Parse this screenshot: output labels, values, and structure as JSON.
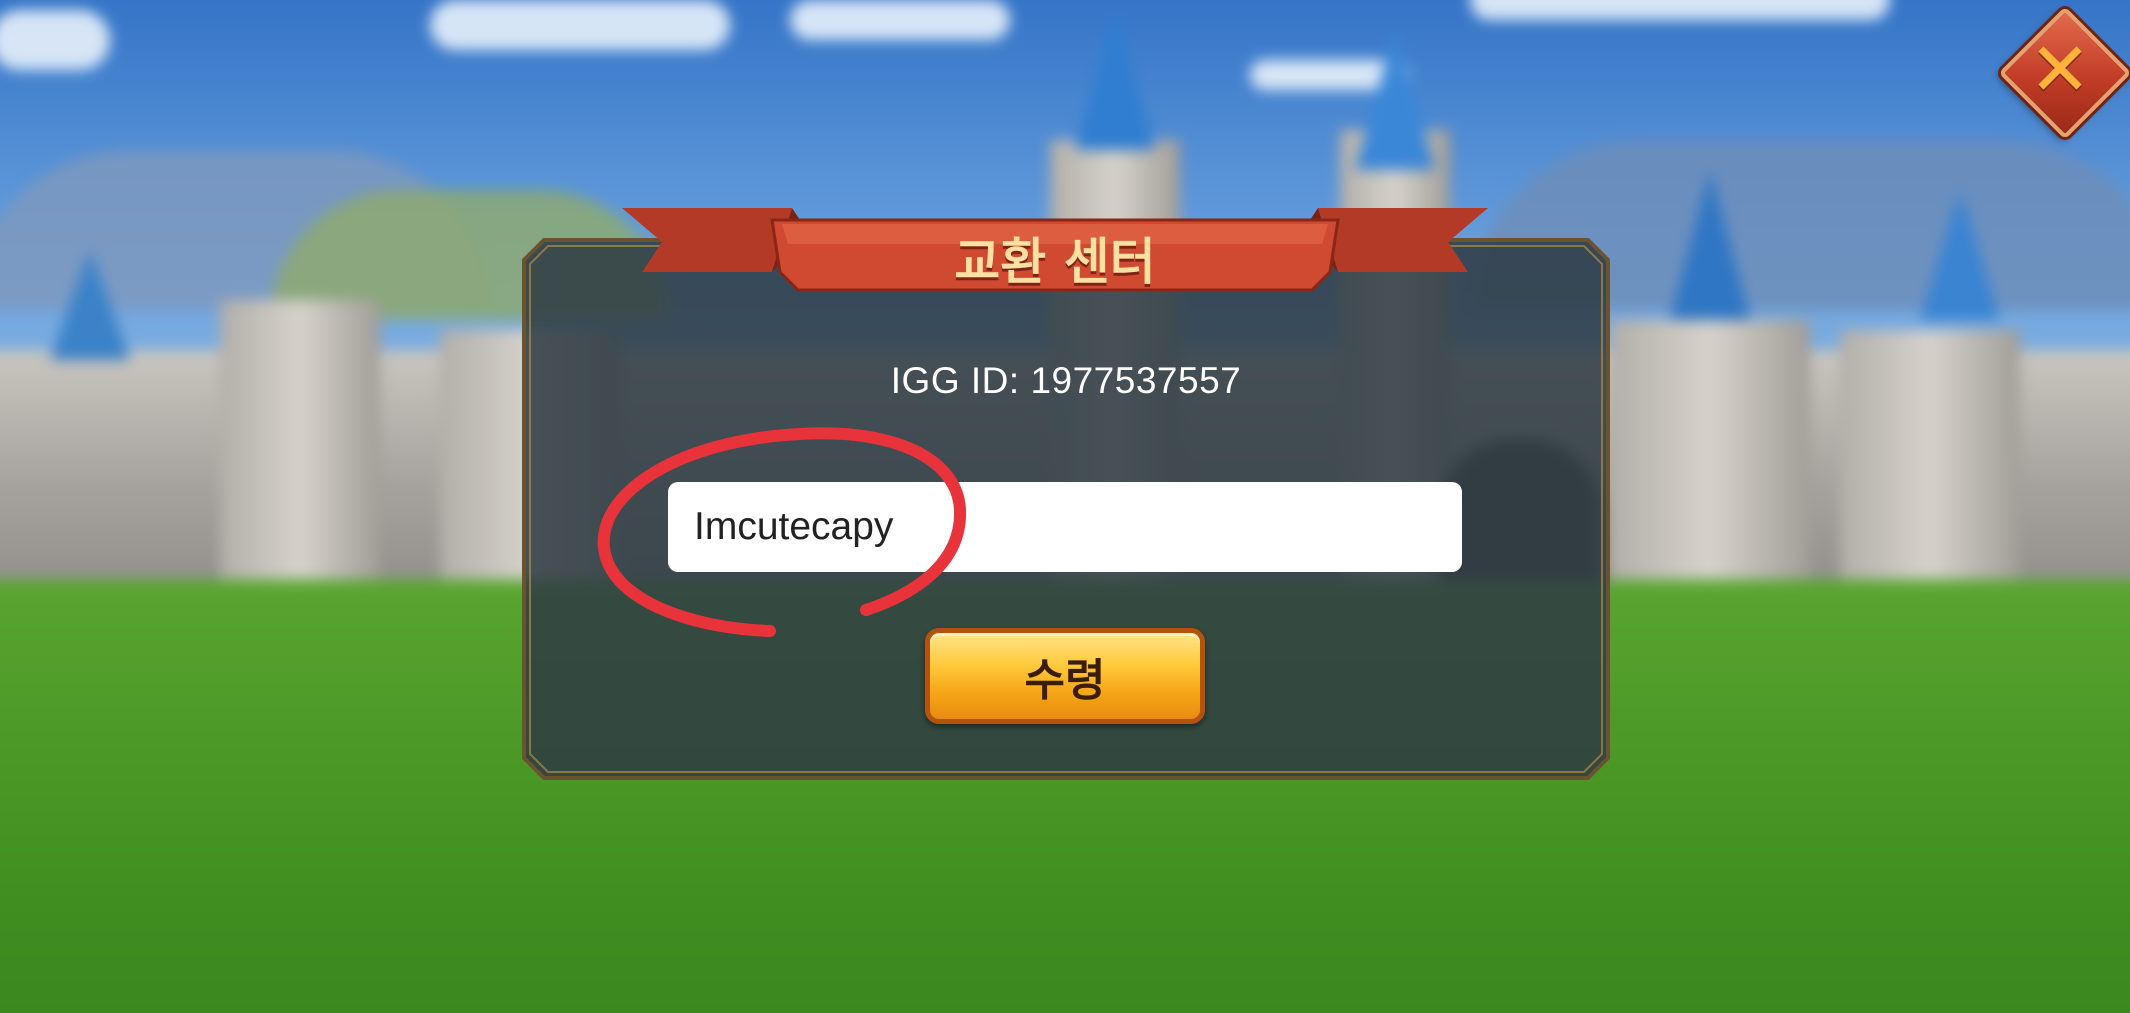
{
  "dialog": {
    "title": "교환 센터",
    "igg_id": "IGG ID: 1977537557",
    "code_input": {
      "value": "Imcutecapy",
      "placeholder": ""
    },
    "claim_label": "수령"
  },
  "close": {
    "icon": "close-icon",
    "glyph": "✕"
  },
  "colors": {
    "banner_red": "#c6432c",
    "panel_dark": "#2f3b44",
    "panel_border": "#b48a45",
    "button_gold": "#ffc93a",
    "close_red": "#c13c26",
    "annotation_red": "#e8333b"
  }
}
